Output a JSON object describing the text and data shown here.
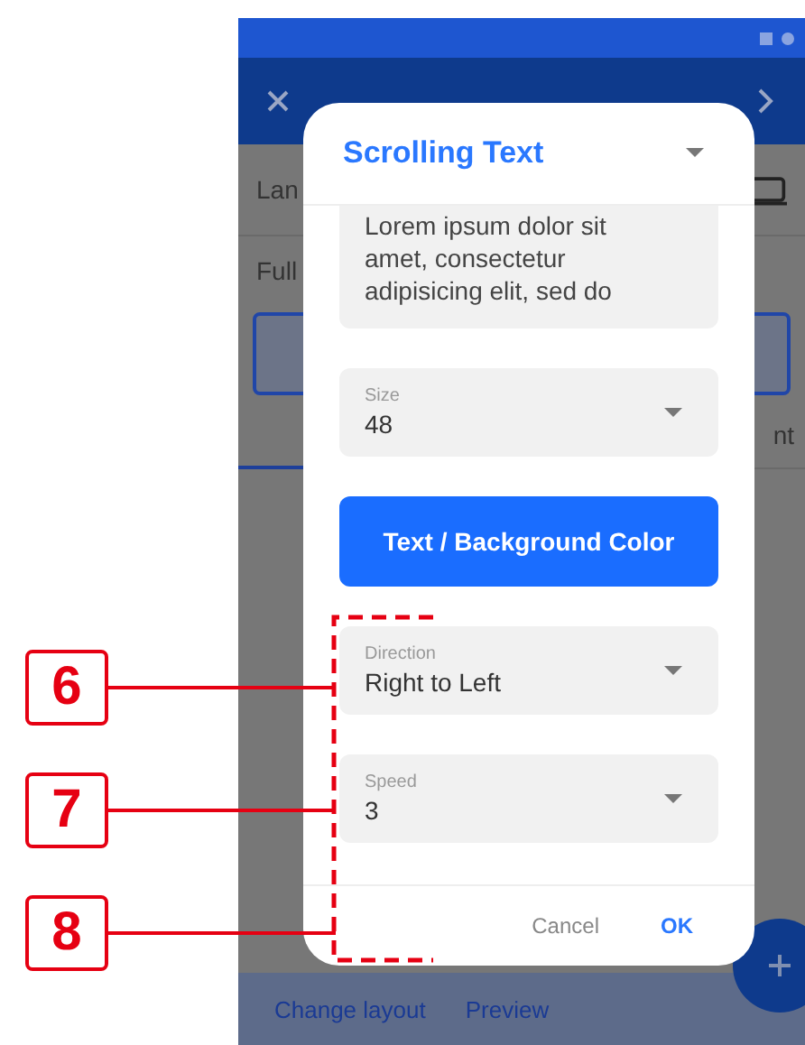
{
  "background": {
    "row_labels": [
      "Lan",
      "Full"
    ],
    "tab_label": "nt"
  },
  "bottom_bar": {
    "actions": [
      "Change layout",
      "Preview"
    ]
  },
  "dialog": {
    "title": "Scrolling Text",
    "text": "Lorem ipsum dolor sit amet, consectetur adipisicing elit, sed do",
    "items": [
      {
        "kind": "select",
        "label": "Size",
        "value": "48"
      },
      {
        "kind": "button",
        "label": "Text / Background Color"
      },
      {
        "kind": "select",
        "label": "Direction",
        "value": "Right to Left"
      },
      {
        "kind": "select",
        "label": "Speed",
        "value": "3"
      }
    ],
    "actions": [
      {
        "label": "Cancel",
        "primary": false
      },
      {
        "label": "OK",
        "primary": true
      }
    ]
  },
  "callouts": [
    "6",
    "7",
    "8"
  ]
}
